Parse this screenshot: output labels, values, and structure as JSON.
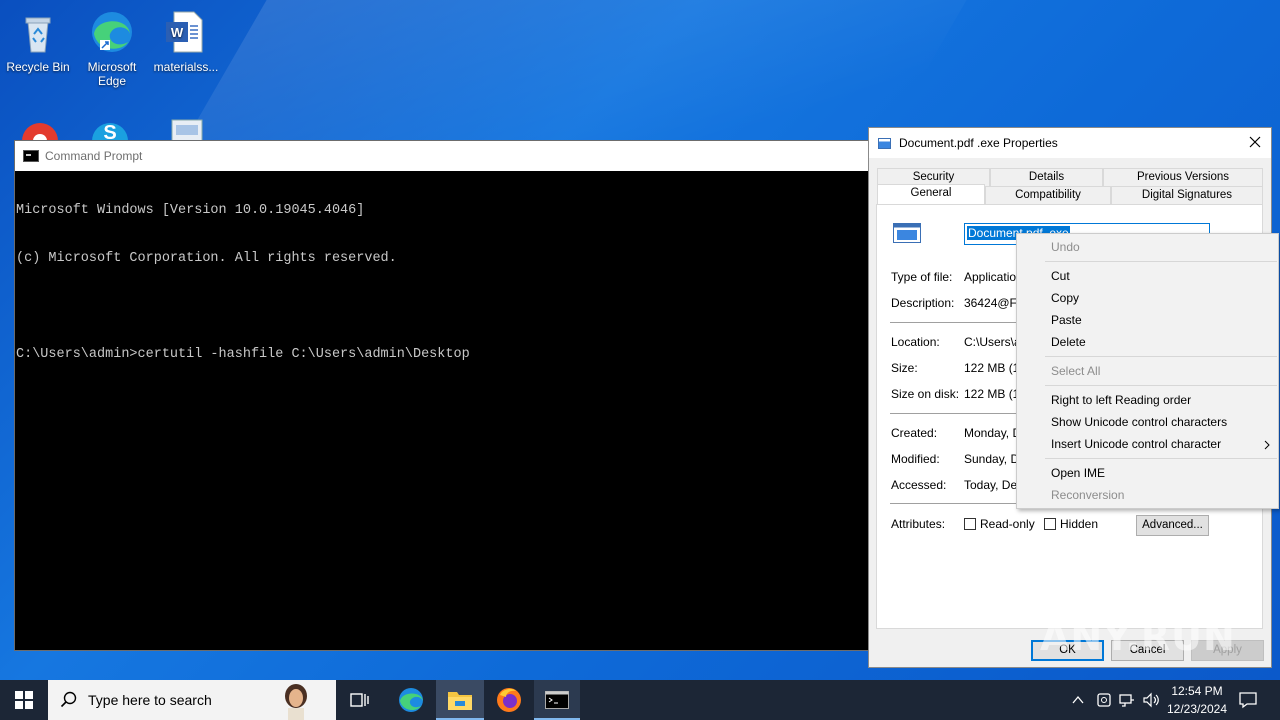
{
  "desktop": {
    "icons": [
      {
        "label": "Recycle Bin",
        "icon": "recycle-bin-icon"
      },
      {
        "label": "Microsoft Edge",
        "icon": "edge-icon"
      },
      {
        "label": "materialss...",
        "icon": "word-document-icon"
      }
    ]
  },
  "cmd": {
    "title": "Command Prompt",
    "lines": [
      "Microsoft Windows [Version 10.0.19045.4046]",
      "(c) Microsoft Corporation. All rights reserved.",
      "",
      "C:\\Users\\admin>certutil -hashfile C:\\Users\\admin\\Desktop"
    ]
  },
  "props": {
    "title": "Document.pdf .exe Properties",
    "tabs_row1": [
      "Security",
      "Details",
      "Previous Versions"
    ],
    "tabs_row2": [
      "General",
      "Compatibility",
      "Digital Signatures"
    ],
    "name_value": "Document.pdf .exe",
    "fields": {
      "type_label": "Type of file:",
      "type_value": "Application",
      "desc_label": "Description:",
      "desc_value": "36424@F,D",
      "loc_label": "Location:",
      "loc_value": "C:\\Users\\a",
      "size_label": "Size:",
      "size_value": "122 MB (12",
      "disk_label": "Size on disk:",
      "disk_value": "122 MB (12",
      "created_label": "Created:",
      "created_value": "Monday, D",
      "modified_label": "Modified:",
      "modified_value": "Sunday, De",
      "accessed_label": "Accessed:",
      "accessed_value": "Today, Dec",
      "attr_label": "Attributes:",
      "readonly": "Read-only",
      "hidden": "Hidden",
      "advanced": "Advanced..."
    },
    "buttons": {
      "ok": "OK",
      "cancel": "Cancel",
      "apply": "Apply"
    }
  },
  "context_menu": {
    "undo": "Undo",
    "cut": "Cut",
    "copy": "Copy",
    "paste": "Paste",
    "delete": "Delete",
    "select_all": "Select All",
    "rtl": "Right to left Reading order",
    "show_unicode": "Show Unicode control characters",
    "insert_unicode": "Insert Unicode control character",
    "open_ime": "Open IME",
    "reconversion": "Reconversion"
  },
  "watermark": "ANY.RUN",
  "taskbar": {
    "search_placeholder": "Type here to search",
    "time": "12:54 PM",
    "date": "12/23/2024"
  }
}
